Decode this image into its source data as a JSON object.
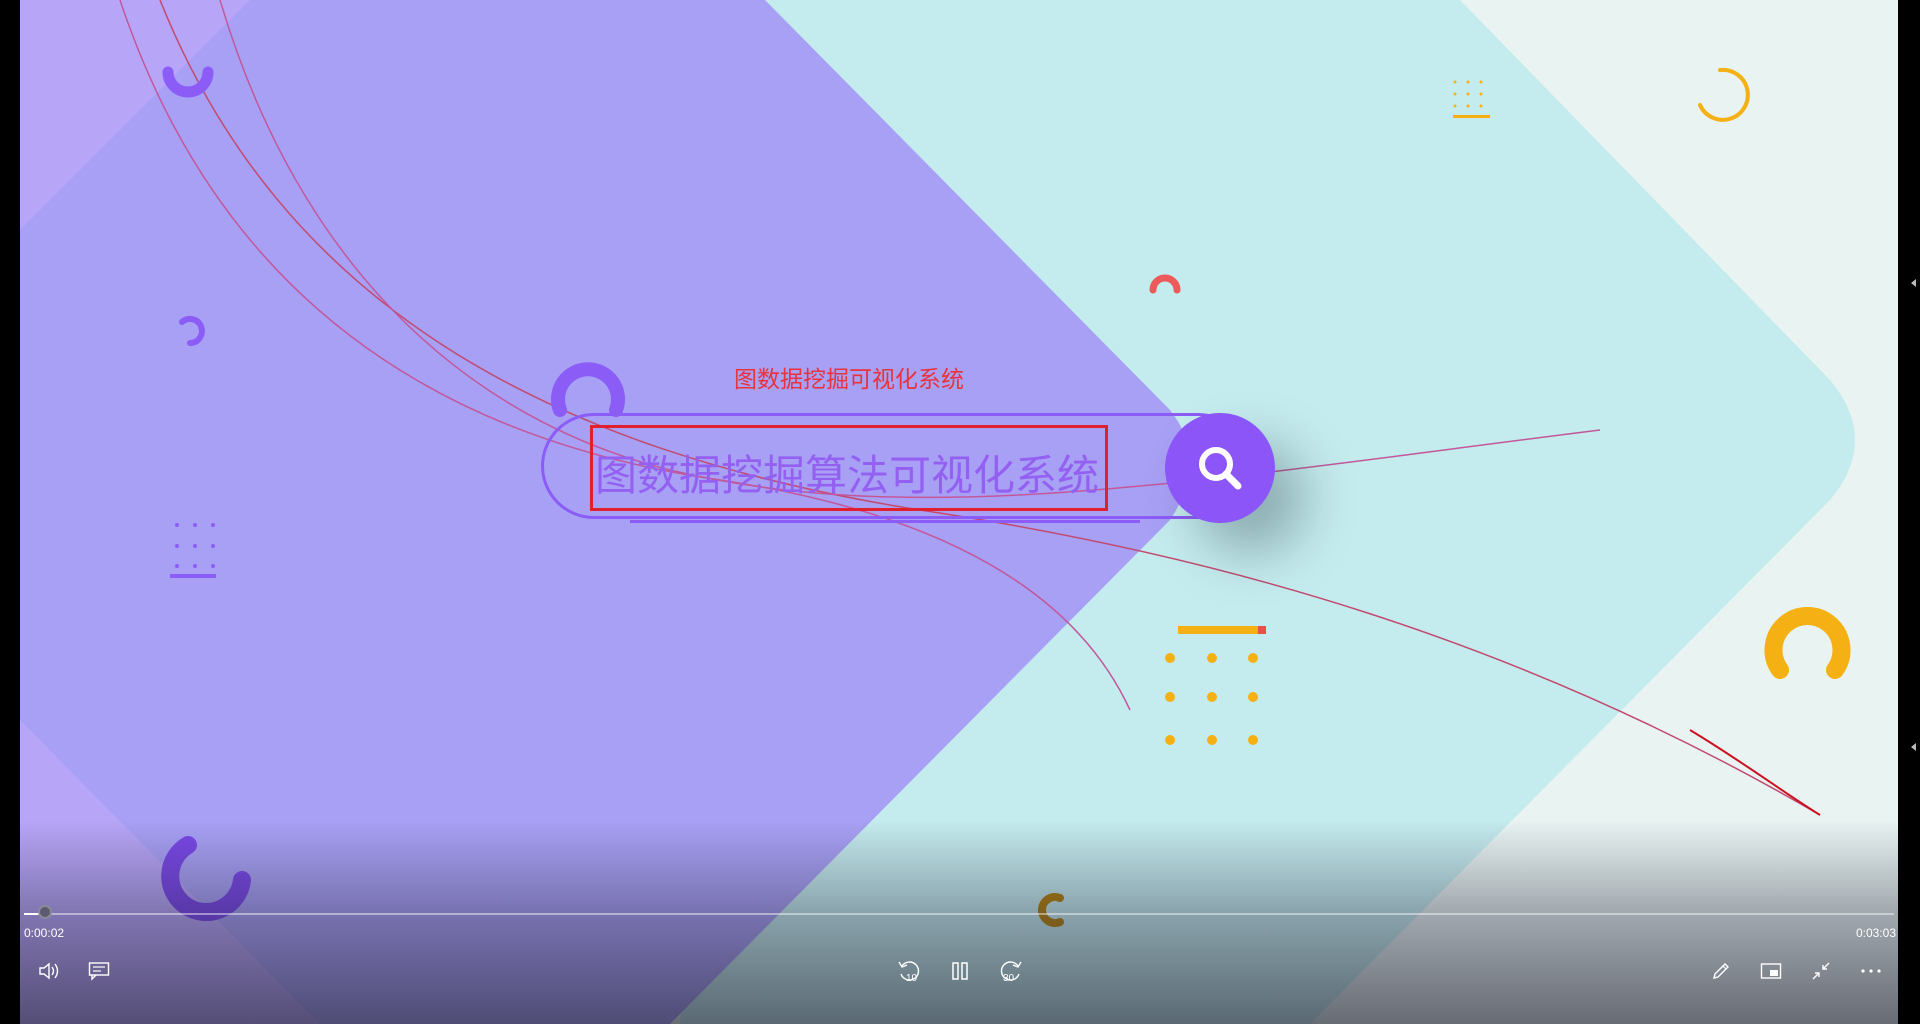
{
  "slide": {
    "subtitle": "图数据挖掘可视化系统",
    "search_text": "图数据挖掘算法可视化系统"
  },
  "player": {
    "current_time": "0:00:02",
    "total_time": "0:03:03",
    "progress": 0.011,
    "icons": {
      "volume": "volume-icon",
      "captions": "captions-icon",
      "skip_back": "skip-back-10-icon",
      "pause": "pause-icon",
      "skip_forward": "skip-forward-30-icon",
      "edit": "pencil-icon",
      "miniview": "mini-view-icon",
      "exit_fullscreen": "exit-fullscreen-icon",
      "more": "more-icon",
      "search": "search-icon"
    },
    "skip_back_label": "10",
    "skip_forward_label": "30"
  },
  "colors": {
    "purple": "#8b5cf6",
    "lavender": "#a8a0f5",
    "teal": "#c4ebee",
    "accent_red": "#e0202e",
    "yellow": "#f5b014"
  }
}
